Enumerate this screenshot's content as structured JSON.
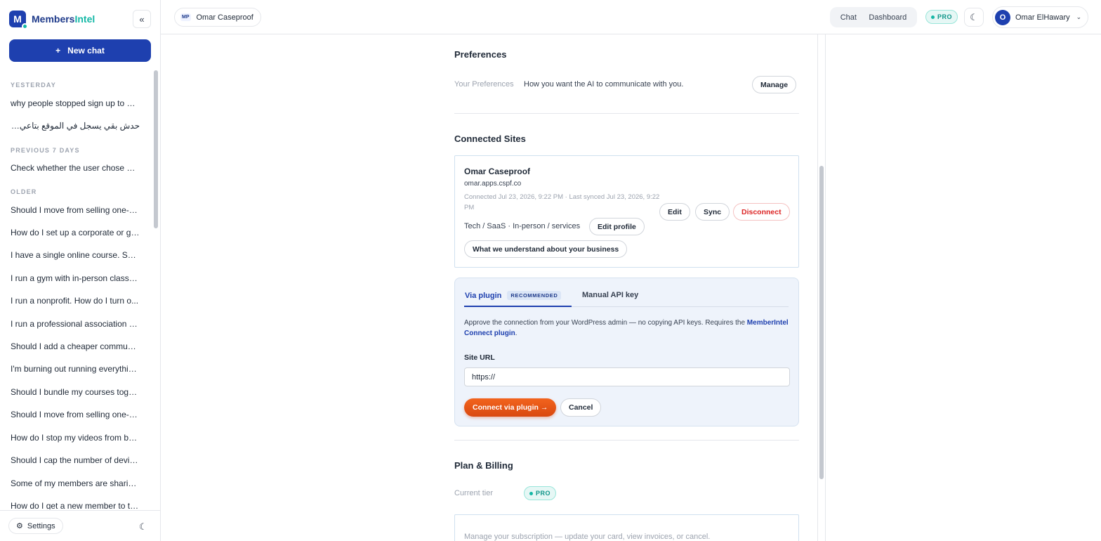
{
  "brand": {
    "prefix": "Members",
    "suffix": "Intel",
    "logo_letter": "M"
  },
  "sidebar": {
    "new_chat_label": "New chat",
    "sections": {
      "yesterday": "YESTERDAY",
      "previous7": "PREVIOUS 7 DAYS",
      "older": "OLDER"
    },
    "yesterday_items": [
      "why people stopped sign up to m...",
      "حدش بقي يسجل في الموقع بتاعي مش فاهم..."
    ],
    "previous7_items": [
      "Check whether the user chose a v..."
    ],
    "older_items": [
      "Should I move from selling one-o...",
      "How do I set up a corporate or gr...",
      "I have a single online course. Sho...",
      "I run a gym with in-person classe...",
      "I run a nonprofit. How do I turn o...",
      "I run a professional association w...",
      "Should I add a cheaper communi...",
      "I'm burning out running everythin...",
      "Should I bundle my courses toget...",
      "Should I move from selling one-o...",
      "How do I stop my videos from bei...",
      "Should I cap the number of devic...",
      "Some of my members are sharin...",
      "How do I get a new member to th..."
    ],
    "settings_label": "Settings"
  },
  "topbar": {
    "site_badge": "MP",
    "site_name": "Omar Caseproof",
    "seg_chat": "Chat",
    "seg_dashboard": "Dashboard",
    "pro_label": "PRO",
    "user_initial": "O",
    "user_name": "Omar ElHawary"
  },
  "preferences": {
    "title": "Preferences",
    "row_label": "Your Preferences",
    "row_value": "How you want the AI to communicate with you.",
    "manage_label": "Manage"
  },
  "connected_sites": {
    "title": "Connected Sites",
    "site": {
      "name": "Omar Caseproof",
      "domain": "omar.apps.cspf.co",
      "meta_line1": "Connected Jul 23, 2026, 9:22 PM · Last synced Jul 23, 2026, 9:22",
      "meta_line2": "PM",
      "industry": "Tech / SaaS · In-person / services",
      "edit_profile_label": "Edit profile",
      "understand_label": "What we understand about your business",
      "edit_label": "Edit",
      "sync_label": "Sync",
      "disconnect_label": "Disconnect"
    },
    "connect": {
      "tab_plugin": "Via plugin",
      "tab_badge": "RECOMMENDED",
      "tab_manual": "Manual API key",
      "desc_prefix": "Approve the connection from your WordPress admin — no copying API keys. Requires the ",
      "desc_link": "MemberIntel Connect plugin",
      "desc_suffix": ".",
      "url_label": "Site URL",
      "url_value": "https://",
      "connect_label": "Connect via plugin →",
      "cancel_label": "Cancel"
    }
  },
  "billing": {
    "title": "Plan & Billing",
    "tier_label": "Current tier",
    "tier_value": "PRO",
    "manage_text": "Manage your subscription — update your card, view invoices, or cancel."
  },
  "colors": {
    "brand_blue": "#1e40af",
    "teal": "#14b8a6",
    "danger": "#dc2626",
    "orange": "#e8551a"
  }
}
